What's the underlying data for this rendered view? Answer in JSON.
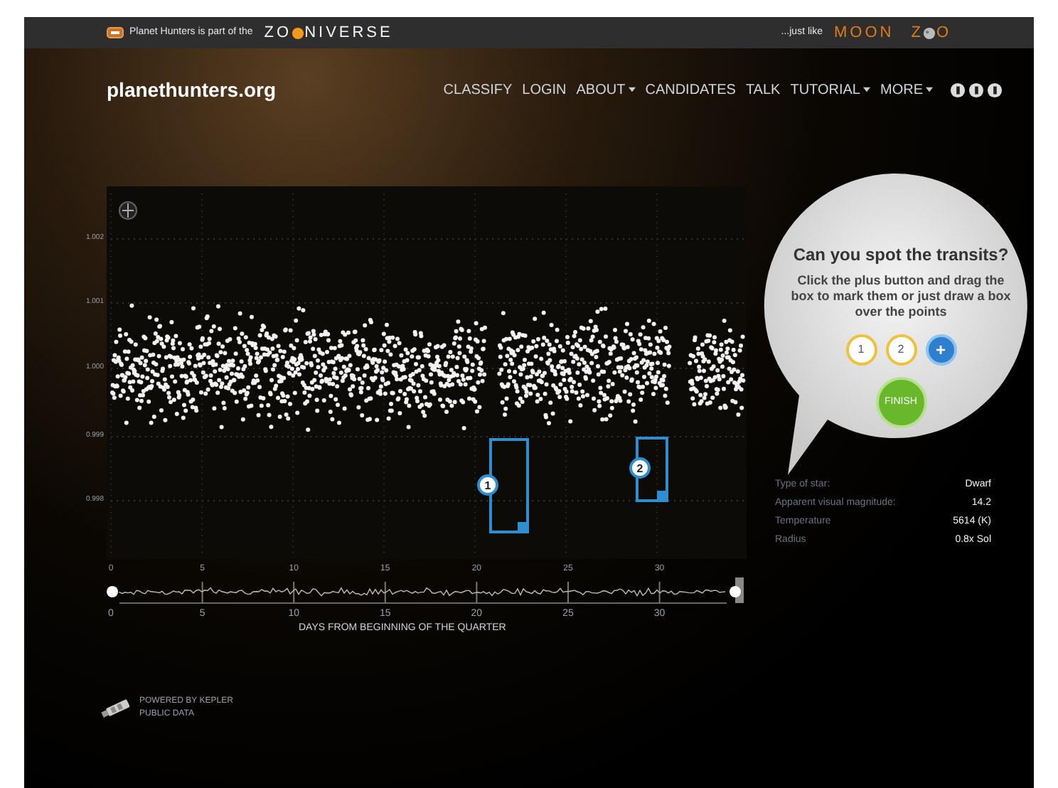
{
  "top_bar": {
    "intro": "Planet Hunters is part of the",
    "zooniverse_logo": [
      "ZO",
      "NIVERSE"
    ],
    "tagline": "...just like",
    "moonzoo_logo": [
      "MOON",
      "Z",
      "O"
    ]
  },
  "header": {
    "site_name": "planethunters.org",
    "nav": [
      {
        "label": "CLASSIFY",
        "has_menu": false
      },
      {
        "label": "LOGIN",
        "has_menu": false
      },
      {
        "label": "ABOUT",
        "has_menu": true
      },
      {
        "label": "CANDIDATES",
        "has_menu": false
      },
      {
        "label": "TALK",
        "has_menu": false
      },
      {
        "label": "TUTORIAL",
        "has_menu": true
      },
      {
        "label": "MORE",
        "has_menu": true
      }
    ]
  },
  "chart": {
    "y_ticks": [
      "1.002",
      "1.001",
      "1.000",
      "0.999",
      "0.998"
    ],
    "markers": [
      {
        "number": "1"
      },
      {
        "number": "2"
      }
    ]
  },
  "prompt": {
    "title": "Can you spot the transits?",
    "text": "Click the plus button and drag the box to mark them or just draw a box over the points",
    "buttons": [
      {
        "kind": "number",
        "label": "1"
      },
      {
        "kind": "number",
        "label": "2"
      },
      {
        "kind": "add",
        "label": "+"
      }
    ],
    "finish": "FINISH"
  },
  "star_info": [
    {
      "label": "Type of star:",
      "value": "Dwarf"
    },
    {
      "label": "Apparent visual magnitude:",
      "value": "14.2"
    },
    {
      "label": "Temperature",
      "value": "5614 (K)"
    },
    {
      "label": "Radius",
      "value": "0.8x Sol"
    }
  ],
  "slider": {
    "top_ticks": [
      "0",
      "5",
      "10",
      "15",
      "20",
      "25",
      "30"
    ],
    "bottom_ticks": [
      "0",
      "5",
      "10",
      "15",
      "20",
      "25",
      "30"
    ],
    "xlabel": "DAYS FROM BEGINNING OF THE QUARTER"
  },
  "footer": {
    "lines": [
      "POWERED BY KEPLER",
      "PUBLIC DATA"
    ]
  }
}
